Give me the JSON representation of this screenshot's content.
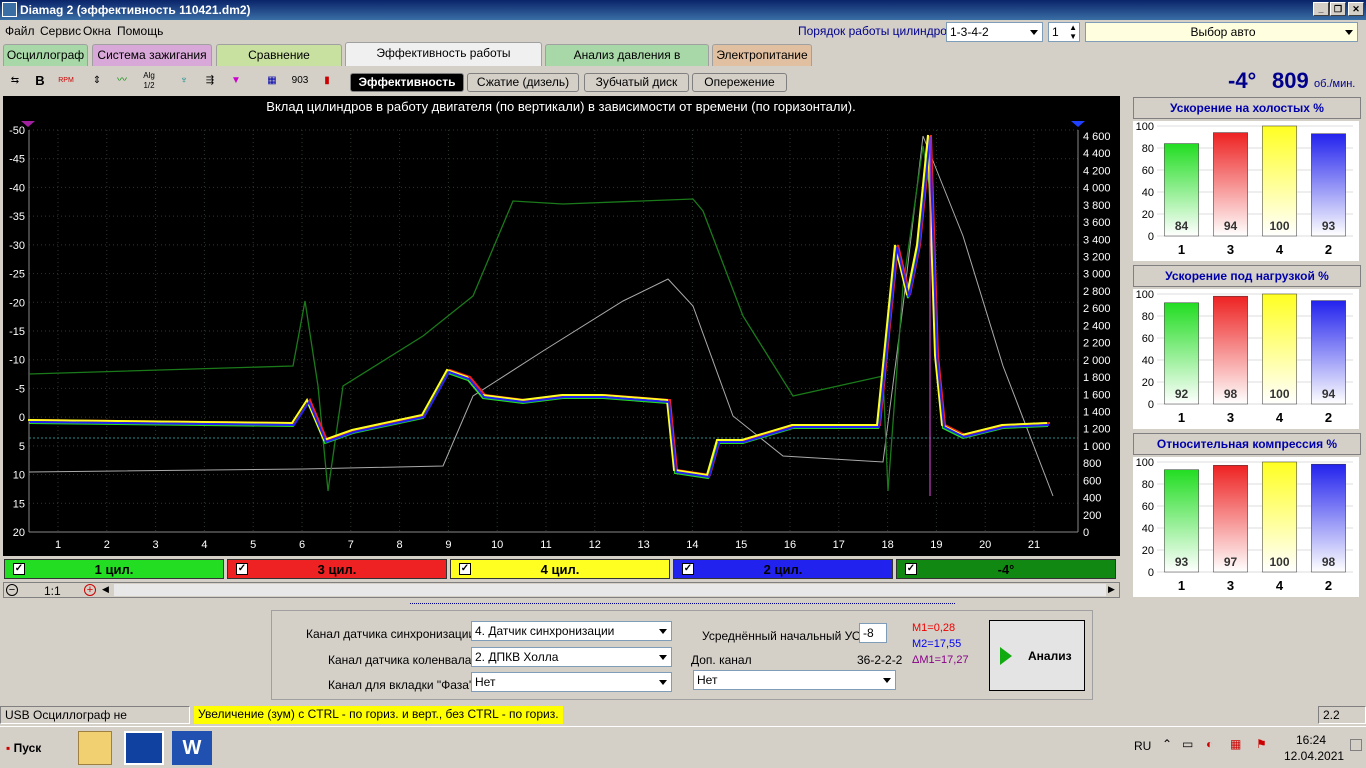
{
  "window": {
    "title": "Diamag 2 (эффективность 110421.dm2)"
  },
  "menu": [
    "Файл",
    "Сервис",
    "Окна",
    "Помощь"
  ],
  "header": {
    "cyl_order_label": "Порядок работы цилиндров",
    "cyl_order_value": "1-3-4-2",
    "spin_value": "1",
    "car_select": "Выбор авто"
  },
  "tabs": [
    {
      "label": "Осциллограф",
      "color": "#a8d8a8"
    },
    {
      "label": "Система зажигания",
      "color": "#d8a8d8"
    },
    {
      "label": "Сравнение цилиндров",
      "color": "#c8e0a0"
    },
    {
      "label": "Эффективность работы цилиндров",
      "color": "#f0f0f0"
    },
    {
      "label": "Анализ давления в цилиндре",
      "color": "#a8d8a8"
    },
    {
      "label": "Электропитание",
      "color": "#e0c0a0"
    }
  ],
  "subtabs": [
    "Эффективность",
    "Сжатие (дизель)",
    "Зубчатый диск",
    "Опережение"
  ],
  "readout": {
    "angle": "-4°",
    "rpm": "809",
    "rpm_unit": "об./мин."
  },
  "toolbar_icons": [
    "sync-icon",
    "bold-icon",
    "rpm-icon",
    "scale-icon",
    "waveform-icon",
    "algorithm-icon",
    "tree-icon",
    "order-icon",
    "filter-icon",
    "engine-icon",
    "vqs-icon",
    "bar-icon"
  ],
  "toolbar_text": {
    "bold": "B",
    "rpm": "RPM",
    "alg": "Alg 1/2",
    "vqs": "903"
  },
  "main_chart": {
    "title": "Вклад цилиндров в работу двигателя (по вертикали) в зависимости от времени (по горизонтали).",
    "left_ticks": [
      "-50",
      "-45",
      "-40",
      "-35",
      "-30",
      "-25",
      "-20",
      "-15",
      "-10",
      "-5",
      "0",
      "5",
      "10",
      "15",
      "20"
    ],
    "right_ticks": [
      "4 600",
      "4 400",
      "4 200",
      "4 000",
      "3 800",
      "3 600",
      "3 400",
      "3 200",
      "3 000",
      "2 800",
      "2 600",
      "2 400",
      "2 200",
      "2 000",
      "1 800",
      "1 600",
      "1 400",
      "1 200",
      "1 000",
      "800",
      "600",
      "400",
      "200",
      "0"
    ],
    "x_ticks": [
      "1",
      "2",
      "3",
      "4",
      "5",
      "6",
      "7",
      "8",
      "9",
      "10",
      "11",
      "12",
      "13",
      "14",
      "15",
      "16",
      "17",
      "18",
      "19",
      "20",
      "21"
    ]
  },
  "channels": [
    {
      "label": "1 цил.",
      "color": "#22dd22"
    },
    {
      "label": "3 цил.",
      "color": "#ee2222"
    },
    {
      "label": "4 цил.",
      "color": "#ffff22"
    },
    {
      "label": "2 цил.",
      "color": "#2222ee"
    },
    {
      "label": "-4°",
      "color": "#118811"
    }
  ],
  "zoom": {
    "value": "1:1"
  },
  "chart_data": [
    {
      "type": "bar",
      "title": "Ускорение на холостых %",
      "categories": [
        "1",
        "3",
        "4",
        "2"
      ],
      "values": [
        84,
        94,
        100,
        93
      ],
      "ylim": [
        0,
        100
      ],
      "colors": [
        "#22dd22",
        "#ee2222",
        "#ffff22",
        "#2222ee"
      ]
    },
    {
      "type": "bar",
      "title": "Ускорение под нагрузкой %",
      "categories": [
        "1",
        "3",
        "4",
        "2"
      ],
      "values": [
        92,
        98,
        100,
        94
      ],
      "ylim": [
        0,
        100
      ],
      "colors": [
        "#22dd22",
        "#ee2222",
        "#ffff22",
        "#2222ee"
      ]
    },
    {
      "type": "bar",
      "title": "Относительная компрессия %",
      "categories": [
        "1",
        "3",
        "4",
        "2"
      ],
      "values": [
        93,
        97,
        100,
        98
      ],
      "ylim": [
        0,
        100
      ],
      "colors": [
        "#22dd22",
        "#ee2222",
        "#ffff22",
        "#2222ee"
      ]
    }
  ],
  "form": {
    "sync_label": "Канал датчика синхронизации",
    "sync_value": "4.  Датчик синхронизации",
    "crank_label": "Канал датчика коленвала",
    "crank_value": "2.  ДПКВ Холла",
    "phase_label": "Канал для вкладки \"Фаза\"",
    "phase_value": "Нет",
    "avg_label": "Усреднённый начальный УОЗ",
    "avg_value": "-8",
    "extra_label": "Доп. канал",
    "extra_code": "36-2-2-2",
    "extra_value": "Нет",
    "m1": "M1=0,28",
    "m2": "M2=17,55",
    "dm1": "ΔM1=17,27",
    "analyze": "Анализ"
  },
  "status": {
    "left": "USB Осциллограф не подключен",
    "hint": "Увеличение (зум) с CTRL - по гориз. и верт., без CTRL - по гориз.",
    "version": "2.2"
  },
  "taskbar": {
    "start": "Пуск",
    "lang": "RU",
    "time": "16:24",
    "date": "12.04.2021"
  }
}
